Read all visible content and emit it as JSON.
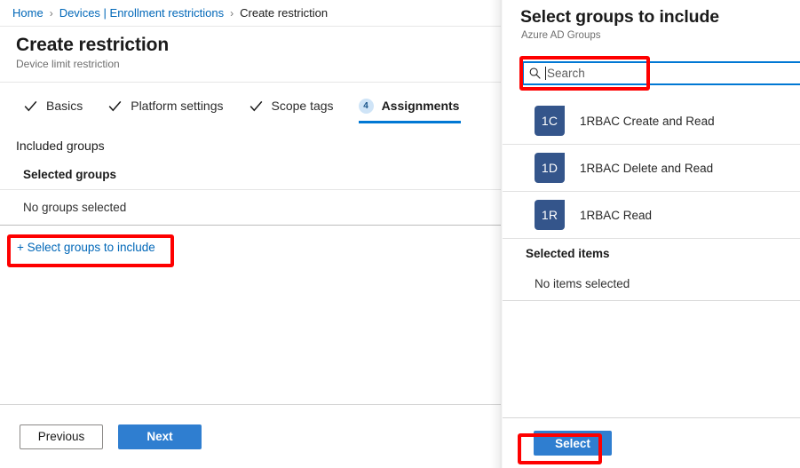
{
  "breadcrumb": {
    "items": [
      {
        "label": "Home",
        "type": "link"
      },
      {
        "label": "Devices | Enrollment restrictions",
        "type": "link"
      },
      {
        "label": "Create restriction",
        "type": "current"
      }
    ],
    "separator": "›"
  },
  "left_blade": {
    "title": "Create restriction",
    "subtitle": "Device limit restriction",
    "tabs": [
      {
        "label": "Basics",
        "state": "complete",
        "icon": "check-icon"
      },
      {
        "label": "Platform settings",
        "state": "complete",
        "icon": "check-icon"
      },
      {
        "label": "Scope tags",
        "state": "complete",
        "icon": "check-icon"
      },
      {
        "label": "Assignments",
        "state": "active",
        "badge": "4"
      }
    ],
    "section_label": "Included groups",
    "table": {
      "column_header": "Selected groups",
      "empty_text": "No groups selected"
    },
    "add_link": "+ Select groups to include",
    "footer": {
      "previous_label": "Previous",
      "next_label": "Next"
    }
  },
  "right_panel": {
    "title": "Select groups to include",
    "subtitle": "Azure AD Groups",
    "search": {
      "icon": "search-icon",
      "placeholder": "Search",
      "value": "",
      "focused": true
    },
    "results": [
      {
        "initials": "1C",
        "label": "1RBAC Create and Read"
      },
      {
        "initials": "1D",
        "label": "1RBAC Delete and Read"
      },
      {
        "initials": "1R",
        "label": "1RBAC Read"
      }
    ],
    "selected_items": {
      "header": "Selected items",
      "empty_text": "No items selected"
    },
    "footer": {
      "select_label": "Select"
    }
  },
  "annotations": {
    "color": "#fe0000",
    "boxes": [
      {
        "target": "add-groups-link"
      },
      {
        "target": "search-input"
      },
      {
        "target": "select-button"
      }
    ]
  },
  "colors": {
    "accent_blue": "#0078d4",
    "link_blue": "#0067b8",
    "primary_button": "#2f7ed0",
    "avatar_blue": "#34558b",
    "badge_bg": "#cfe4f7",
    "annotation_red": "#fe0000"
  }
}
